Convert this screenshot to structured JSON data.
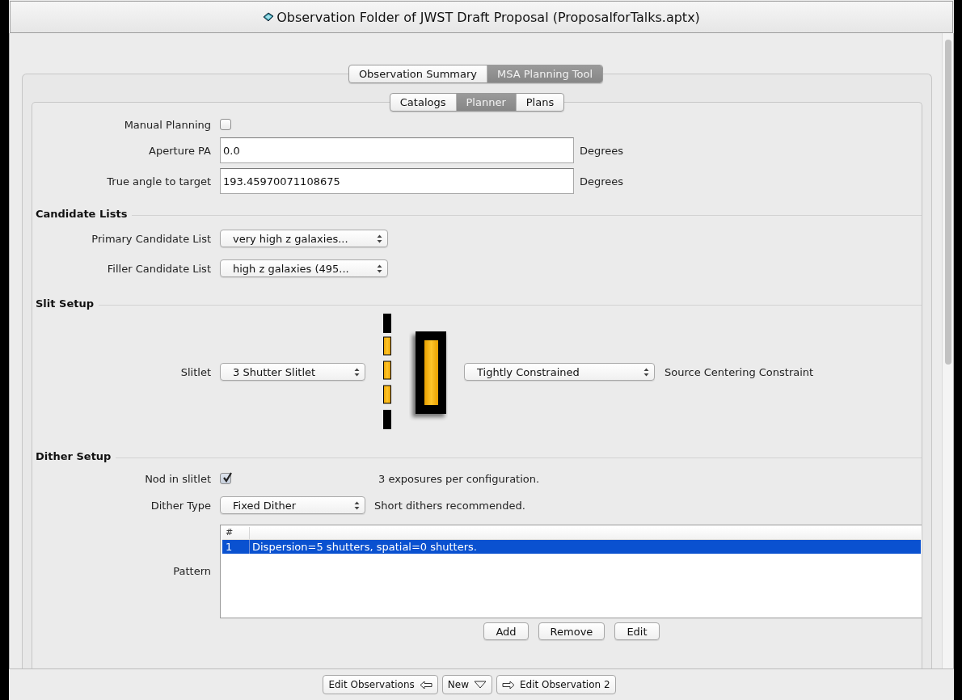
{
  "window": {
    "title": "Observation Folder of JWST Draft Proposal (ProposalforTalks.aptx)"
  },
  "outer_tabs": [
    {
      "label": "Observation Summary",
      "selected": false
    },
    {
      "label": "MSA Planning Tool",
      "selected": true
    }
  ],
  "inner_tabs": [
    {
      "label": "Catalogs",
      "selected": false
    },
    {
      "label": "Planner",
      "selected": true
    },
    {
      "label": "Plans",
      "selected": false
    }
  ],
  "planning": {
    "manual_planning": {
      "label": "Manual Planning",
      "checked": false
    },
    "fields": [
      {
        "label": "Aperture PA",
        "value": "0.0",
        "unit": "Degrees"
      },
      {
        "label": "True angle to target",
        "value": "193.45970071108675",
        "unit": "Degrees"
      }
    ]
  },
  "candidate_lists": {
    "heading": "Candidate Lists",
    "lists": [
      {
        "label": "Primary Candidate List",
        "value": "very high z galaxies..."
      },
      {
        "label": "Filler Candidate List",
        "value": "high z galaxies (495..."
      }
    ]
  },
  "slit_setup": {
    "heading": "Slit Setup",
    "slitlet": {
      "label": "Slitlet",
      "value": "3 Shutter Slitlet"
    },
    "constraint": {
      "value": "Tightly Constrained",
      "label": "Source Centering Constraint"
    }
  },
  "dither_setup": {
    "heading": "Dither Setup",
    "nod": {
      "label": "Nod in slitlet",
      "checked": true,
      "note": "3 exposures per configuration."
    },
    "dither_type": {
      "label": "Dither Type",
      "value": "Fixed Dither",
      "note": "Short dithers recommended."
    },
    "pattern": {
      "label": "Pattern",
      "columns": [
        "#"
      ],
      "rows": [
        {
          "cells": [
            "1",
            "Dispersion=5 shutters, spatial=0 shutters."
          ],
          "selected": true
        }
      ],
      "buttons": [
        "Add",
        "Remove",
        "Edit"
      ]
    }
  },
  "footer_buttons": [
    {
      "label": "Edit Observations",
      "kind": "back"
    },
    {
      "label": "New",
      "kind": "menu"
    },
    {
      "label": "Edit Observation 2",
      "kind": "forward"
    }
  ]
}
